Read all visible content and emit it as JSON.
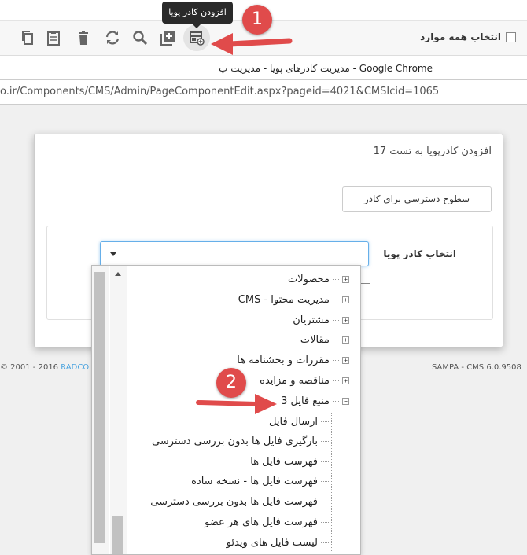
{
  "toolbar": {
    "tooltip": "افزودن کادر پویا",
    "select_all_label": "انتخاب همه موارد",
    "icons": [
      "copy-icon",
      "paste-icon",
      "trash-icon",
      "refresh-icon",
      "search-icon",
      "add-box-icon",
      "add-frame-icon"
    ]
  },
  "markers": {
    "m1": "1",
    "m2": "2"
  },
  "chrome": {
    "title": "مدیریت کادرهای پویا - مدیریت پ - Google Chrome",
    "url": "o.ir/Components/CMS/Admin/PageComponentEdit.aspx?pageid=4021&CMSIcid=1065"
  },
  "dialog": {
    "title": "افزودن کادرپویا به تست 17",
    "access_button": "سطوح دسترسی برای کادر",
    "frame_select_label": "انتخاب کادر پویا",
    "frame_select_value": ""
  },
  "footer": {
    "left_prefix": "© 2001 - 2016 ",
    "left_link": "RADCO",
    "right": "SAMPA - CMS 6.0.9508"
  },
  "tree": {
    "items": [
      {
        "label": "محصولات",
        "expander": "+"
      },
      {
        "label": "مدیریت محتوا - CMS",
        "expander": "+"
      },
      {
        "label": "مشتریان",
        "expander": "+"
      },
      {
        "label": "مقالات",
        "expander": "+"
      },
      {
        "label": "مقررات و بخشنامه ها",
        "expander": "+"
      },
      {
        "label": "مناقصه و مزایده",
        "expander": "+"
      },
      {
        "label": "منبع فایل 3",
        "expander": "−"
      }
    ],
    "children": [
      "ارسال فایل",
      "بارگیری فایل ها بدون بررسی دسترسی",
      "فهرست فایل ها",
      "فهرست فایل ها - نسخه ساده",
      "فهرست فایل ها بدون بررسی دسترسی",
      "فهرست فایل های هر عضو",
      "لیست فایل های ویدئو"
    ]
  },
  "colors": {
    "accent_red": "#e04b4b",
    "link_blue": "#4aa3df",
    "focus_blue": "#66afe9"
  }
}
